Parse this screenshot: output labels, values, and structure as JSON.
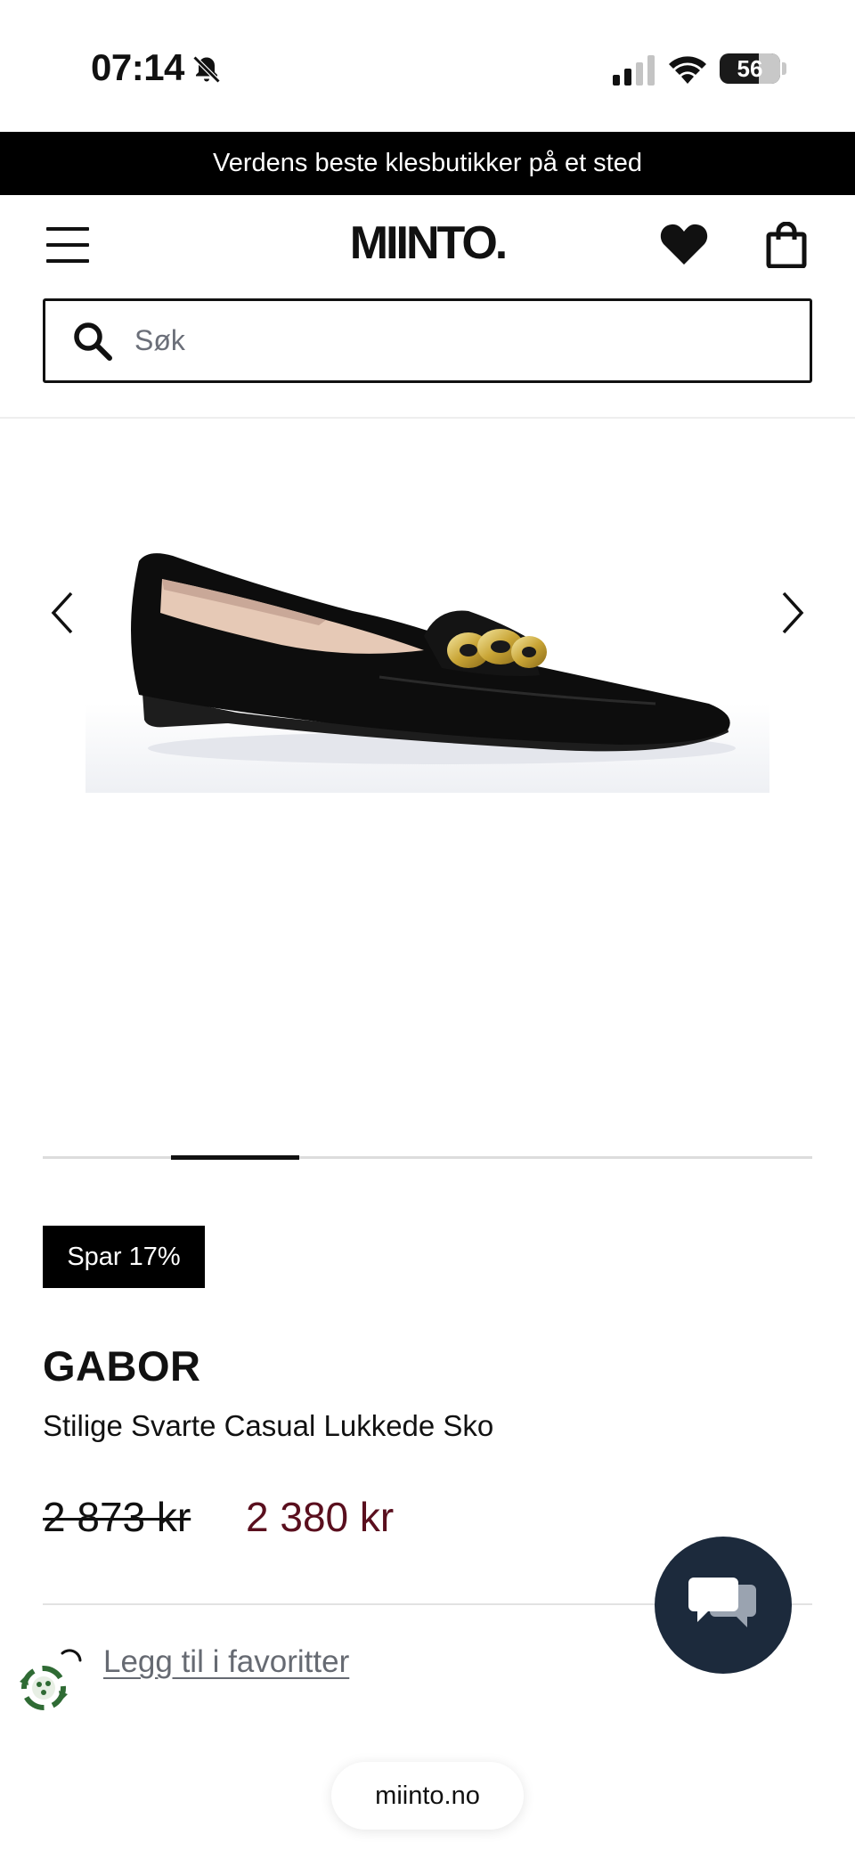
{
  "status_bar": {
    "time": "07:14",
    "battery_level": "56"
  },
  "promo_banner": {
    "text": "Verdens beste klesbutikker på et sted"
  },
  "header": {
    "logo": "MIINTO."
  },
  "search": {
    "placeholder": "Søk"
  },
  "gallery": {
    "progress": 0.1667
  },
  "product": {
    "badge": "Spar 17%",
    "brand": "GABOR",
    "name": "Stilige Svarte Casual Lukkede Sko",
    "price_old": "2 873 kr",
    "price_new": "2 380 kr",
    "favorite_label": "Legg til i favoritter"
  },
  "footer": {
    "domain": "miinto.no"
  },
  "colors": {
    "sale_price": "#5a0f1e",
    "chat_button": "#1c2a3c",
    "banner_bg": "#000000"
  },
  "icons": [
    "bell-muted-icon",
    "cellular-signal-icon",
    "wifi-icon",
    "menu-icon",
    "heart-icon",
    "shopping-bag-icon",
    "search-icon",
    "chevron-left-icon",
    "chevron-right-icon",
    "chat-icon",
    "eco-icon"
  ]
}
